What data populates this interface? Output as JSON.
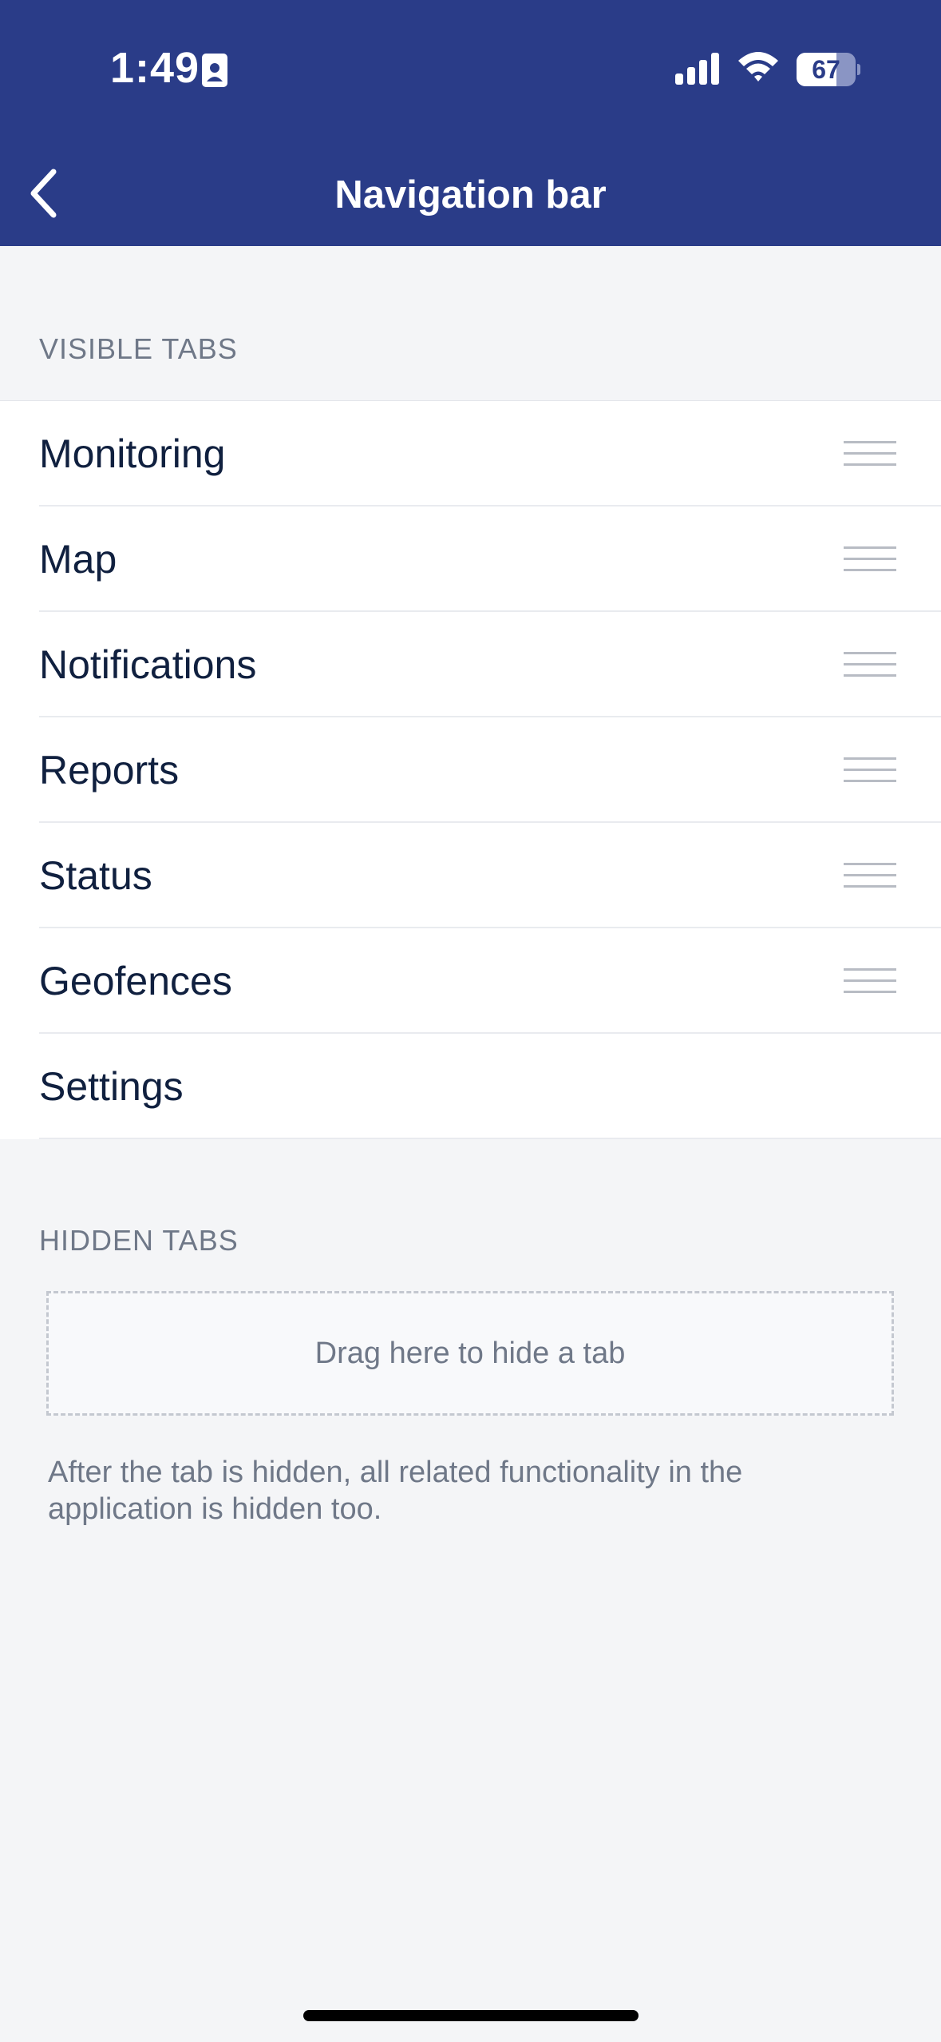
{
  "status_bar": {
    "time": "1:49",
    "battery": "67",
    "battery_level": 0.67
  },
  "header": {
    "title": "Navigation bar",
    "background": "#2a3c88"
  },
  "visible_tabs": {
    "label": "VISIBLE TABS",
    "items": [
      {
        "label": "Monitoring",
        "draggable": true
      },
      {
        "label": "Map",
        "draggable": true
      },
      {
        "label": "Notifications",
        "draggable": true
      },
      {
        "label": "Reports",
        "draggable": true
      },
      {
        "label": "Status",
        "draggable": true
      },
      {
        "label": "Geofences",
        "draggable": true
      },
      {
        "label": "Settings",
        "draggable": false
      }
    ]
  },
  "hidden_tabs": {
    "label": "HIDDEN TABS",
    "drop_zone_text": "Drag here to hide a tab",
    "hint": "After the tab is hidden, all related functionality in the application is hidden too."
  },
  "icons": {
    "back": "chevron-left-icon",
    "drag": "drag-handle-icon",
    "signal": "signal-icon",
    "wifi": "wifi-icon",
    "id_card": "id-card-icon"
  }
}
